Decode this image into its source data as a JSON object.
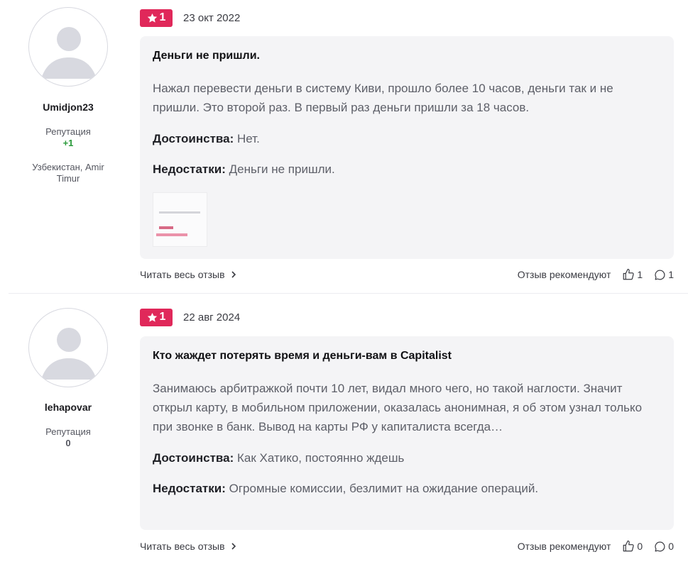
{
  "reviews": [
    {
      "author": {
        "name": "Umidjon23",
        "reputation_label": "Репутация",
        "reputation_value": "+1",
        "location": "Узбекистан, Amir Timur"
      },
      "rating": "1",
      "date": "23 окт 2022",
      "title": "Деньги не пришли.",
      "text": "Нажал перевести деньги в систему Киви, прошло более 10 часов, деньги так и не пришли. Это второй раз. В первый раз деньги пришли за 18 часов.",
      "pros_label": "Достоинства:",
      "pros": "Нет.",
      "cons_label": "Недостатки:",
      "cons": "Деньги не пришли.",
      "read_more": "Читать весь отзыв",
      "recommend_label": "Отзыв рекомендуют",
      "likes": "1",
      "comments": "1"
    },
    {
      "author": {
        "name": "lehapovar",
        "reputation_label": "Репутация",
        "reputation_value": "0"
      },
      "rating": "1",
      "date": "22 авг 2024",
      "title": "Кто жаждет потерять время и деньги-вам в Capitalist",
      "text": "Занимаюсь арбитражкой почти 10 лет, видал много чего, но такой наглости. Значит открыл карту, в мобильном приложении, оказалась анонимная, я об этом узнал только при звонке в банк. Вывод на карты РФ у капиталиста всегда…",
      "pros_label": "Достоинства:",
      "pros": "Как Хатико, постоянно ждешь",
      "cons_label": "Недостатки:",
      "cons": "Огромные комиссии, безлимит на ожидание операций.",
      "read_more": "Читать весь отзыв",
      "recommend_label": "Отзыв рекомендуют",
      "likes": "0",
      "comments": "0"
    }
  ],
  "icons": {
    "star": "star-icon",
    "chevron": "chevron-right-icon",
    "like": "thumbs-up-icon",
    "comment": "comment-icon",
    "avatar": "user-avatar-placeholder"
  },
  "colors": {
    "badge": "#e0285a",
    "reputation_positive": "#2a9a3a",
    "card_bg": "#f4f4f6"
  }
}
